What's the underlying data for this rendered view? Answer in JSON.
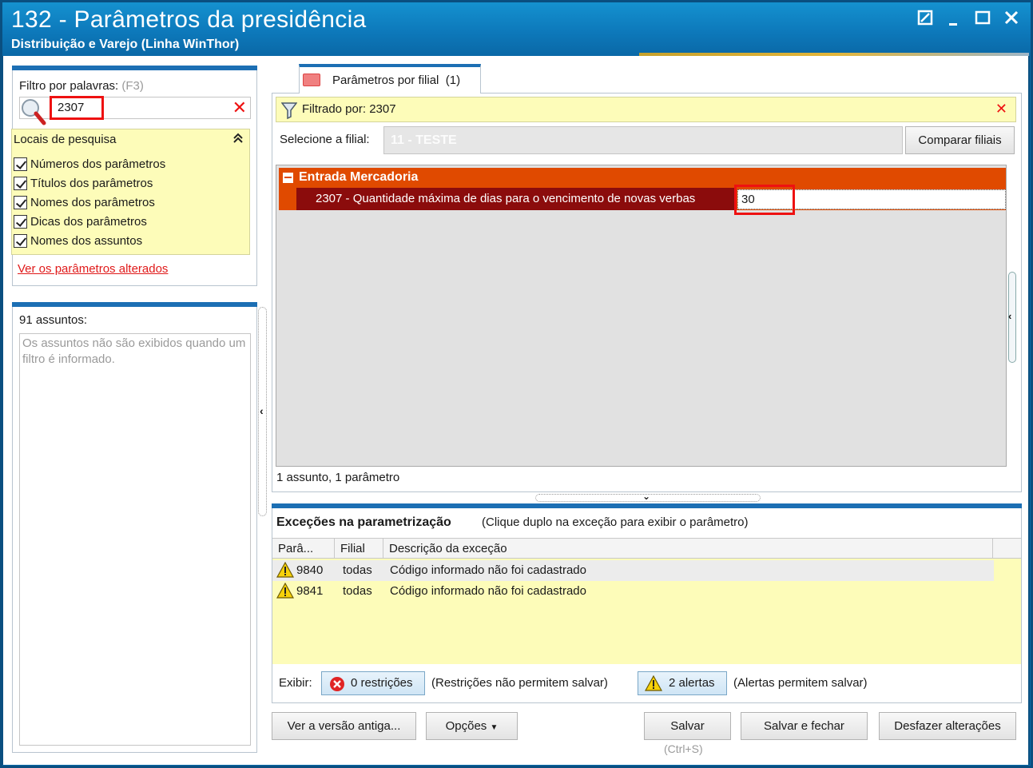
{
  "window": {
    "title": "132 - Parâmetros da presidência",
    "subtitle": "Distribuição e Varejo (Linha WinThor)"
  },
  "filter": {
    "label": "Filtro por palavras:",
    "hint": "(F3)",
    "value": "2307"
  },
  "locais": {
    "title": "Locais de pesquisa",
    "items": [
      {
        "label": "Números dos parâmetros",
        "checked": true
      },
      {
        "label": "Títulos dos parâmetros",
        "checked": true
      },
      {
        "label": "Nomes dos parâmetros",
        "checked": true
      },
      {
        "label": "Dicas dos parâmetros",
        "checked": true
      },
      {
        "label": "Nomes dos assuntos",
        "checked": true
      }
    ]
  },
  "link_changed": "Ver os parâmetros alterados",
  "assuntos": {
    "title": "91 assuntos:",
    "message": "Os assuntos não são exibidos quando um filtro é informado."
  },
  "tab": {
    "label": "Parâmetros por filial",
    "count": "(1)"
  },
  "filtered": {
    "text": "Filtrado por: 2307"
  },
  "filial": {
    "label": "Selecione a filial:",
    "value": "11 - TESTE",
    "compare_button": "Comparar filiais"
  },
  "grid": {
    "group": "Entrada Mercadoria",
    "param_name": "2307 - Quantidade máxima de dias para o vencimento de novas verbas",
    "param_value": "30",
    "summary": "1 assunto, 1 parâmetro"
  },
  "exceptions": {
    "title": "Exceções na parametrização",
    "hint": "(Clique duplo na exceção para exibir o parâmetro)",
    "columns": [
      "Parâ...",
      "Filial",
      "Descrição da exceção"
    ],
    "rows": [
      {
        "param": "9840",
        "filial": "todas",
        "desc": "Código informado não foi cadastrado"
      },
      {
        "param": "9841",
        "filial": "todas",
        "desc": "Código informado não foi cadastrado"
      }
    ],
    "exibir_label": "Exibir:",
    "restricoes": "0 restrições",
    "restricoes_note": "(Restrições não permitem salvar)",
    "alertas": "2 alertas",
    "alertas_note": "(Alertas permitem salvar)"
  },
  "buttons": {
    "old_version": "Ver a versão antiga...",
    "options": "Opções",
    "save": "Salvar",
    "save_hotkey": "(Ctrl+S)",
    "save_close": "Salvar e fechar",
    "undo": "Desfazer alterações"
  },
  "colors": {
    "title_bar": "#0d79bb",
    "group_header": "#e04a00",
    "selected_row": "#8b0c0c",
    "highlight_box": "#ee1111",
    "yellow_panel": "#fdfcb9"
  },
  "icons": [
    "search-icon",
    "close-icon",
    "chevron-up-icon",
    "funnel-icon",
    "folder-icon",
    "warning-icon",
    "error-icon",
    "restore-icon",
    "minimize-icon",
    "maximize-icon"
  ]
}
